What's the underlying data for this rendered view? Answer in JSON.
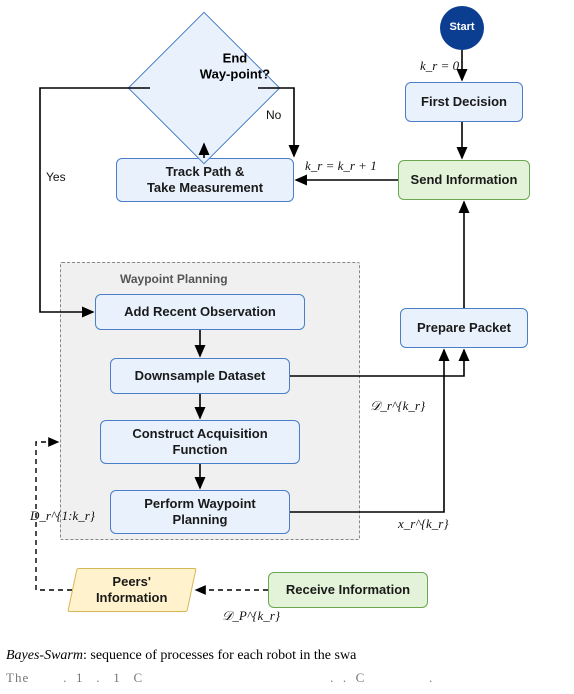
{
  "start": {
    "label": "Start",
    "init": "k_r = 0"
  },
  "first_decision": {
    "label": "First Decision"
  },
  "send_info": {
    "label": "Send Information"
  },
  "increment": "k_r = k_r + 1",
  "track": {
    "label": "Track Path &\nTake Measurement"
  },
  "decision": {
    "label": "End\nWay-point?",
    "yes": "Yes",
    "no": "No"
  },
  "wp": {
    "title": "Waypoint Planning",
    "add_obs": "Add Recent Observation",
    "downsample": "Downsample Dataset",
    "acq": "Construct Acquisition\nFunction",
    "plan": "Perform Waypoint\nPlanning"
  },
  "prepare": {
    "label": "Prepare Packet"
  },
  "peers": {
    "label": "Peers'\nInformation"
  },
  "receive": {
    "label": "Receive Information"
  },
  "edge_labels": {
    "downsample_out": "𝒟_r^{k_r}",
    "plan_out": "x_r^{k_r}",
    "peers_in": "D_r^{1:k_r}",
    "receive_out": "𝒟_P^{k_r}"
  },
  "caption": {
    "name": "Bayes-Swarm",
    "rest": ": sequence of processes for each robot in the swa",
    "line2": "The        .  1   .   1   C                                            .  .  C               ."
  }
}
